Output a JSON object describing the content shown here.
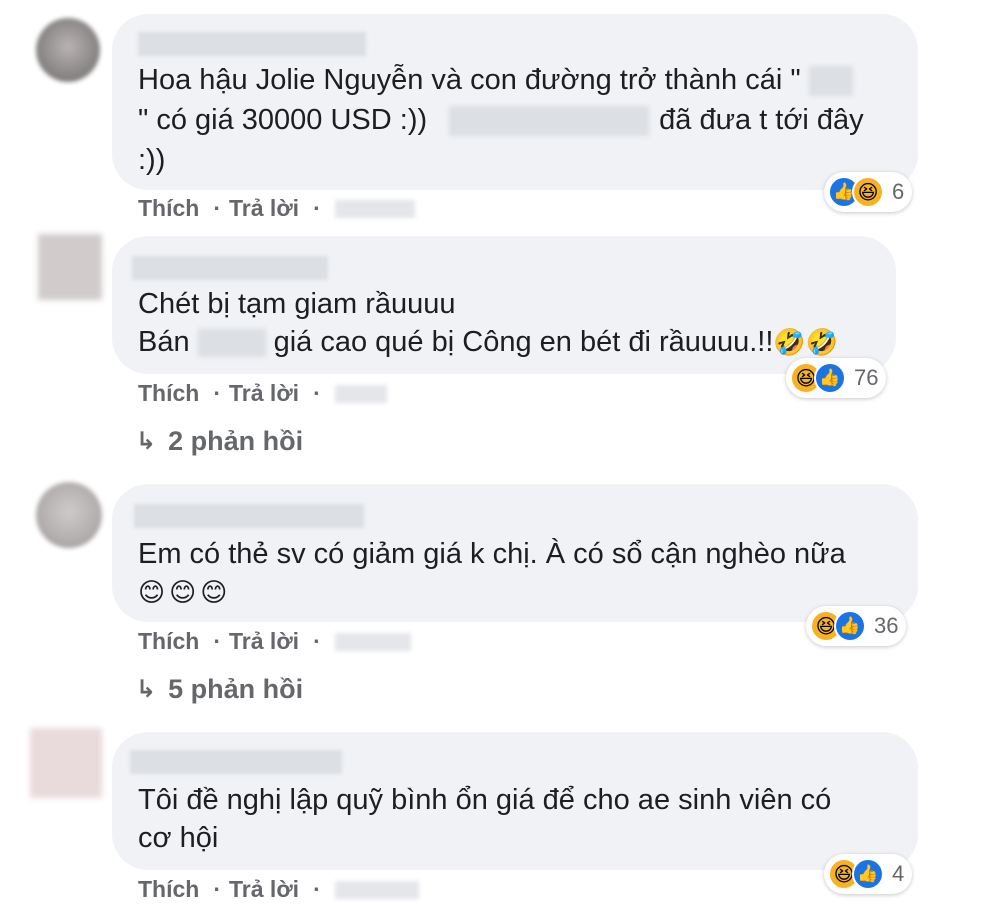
{
  "actions": {
    "like": "Thích",
    "reply": "Trả lời",
    "separator": "·"
  },
  "comments": [
    {
      "line1": "Hoa hậu Jolie Nguyễn và con đường trở thành cái \"",
      "line2_a": "\" có giá 30000 USD :))",
      "line2_b": "đã đưa t tới đây",
      "line3": ":))",
      "reactions": [
        "like-icon",
        "haha-icon"
      ],
      "reaction_count": "6"
    },
    {
      "line1": "Chét bị tạm giam rầuuuu",
      "line2_a": "Bán",
      "line2_b": "giá cao qué bị Công en bét đi rầuuuu.!!",
      "line2_emoji": "🤣🤣",
      "reactions": [
        "haha-icon",
        "like-icon"
      ],
      "reaction_count": "76",
      "replies": "2 phản hồi"
    },
    {
      "line1": "Em có thẻ sv có giảm giá k chị. À có sổ cận nghèo nữa",
      "line2_emoji": "😊😊😊",
      "reactions": [
        "haha-icon",
        "like-icon"
      ],
      "reaction_count": "36",
      "replies": "5 phản hồi"
    },
    {
      "line1": "Tôi đề nghị lập quỹ bình ổn giá để cho ae sinh viên có",
      "line2": "cơ hội",
      "reactions": [
        "haha-icon",
        "like-icon"
      ],
      "reaction_count": "4"
    }
  ],
  "icons": {
    "like": "👍",
    "haha": "😆",
    "reply_arrow": "↳"
  }
}
